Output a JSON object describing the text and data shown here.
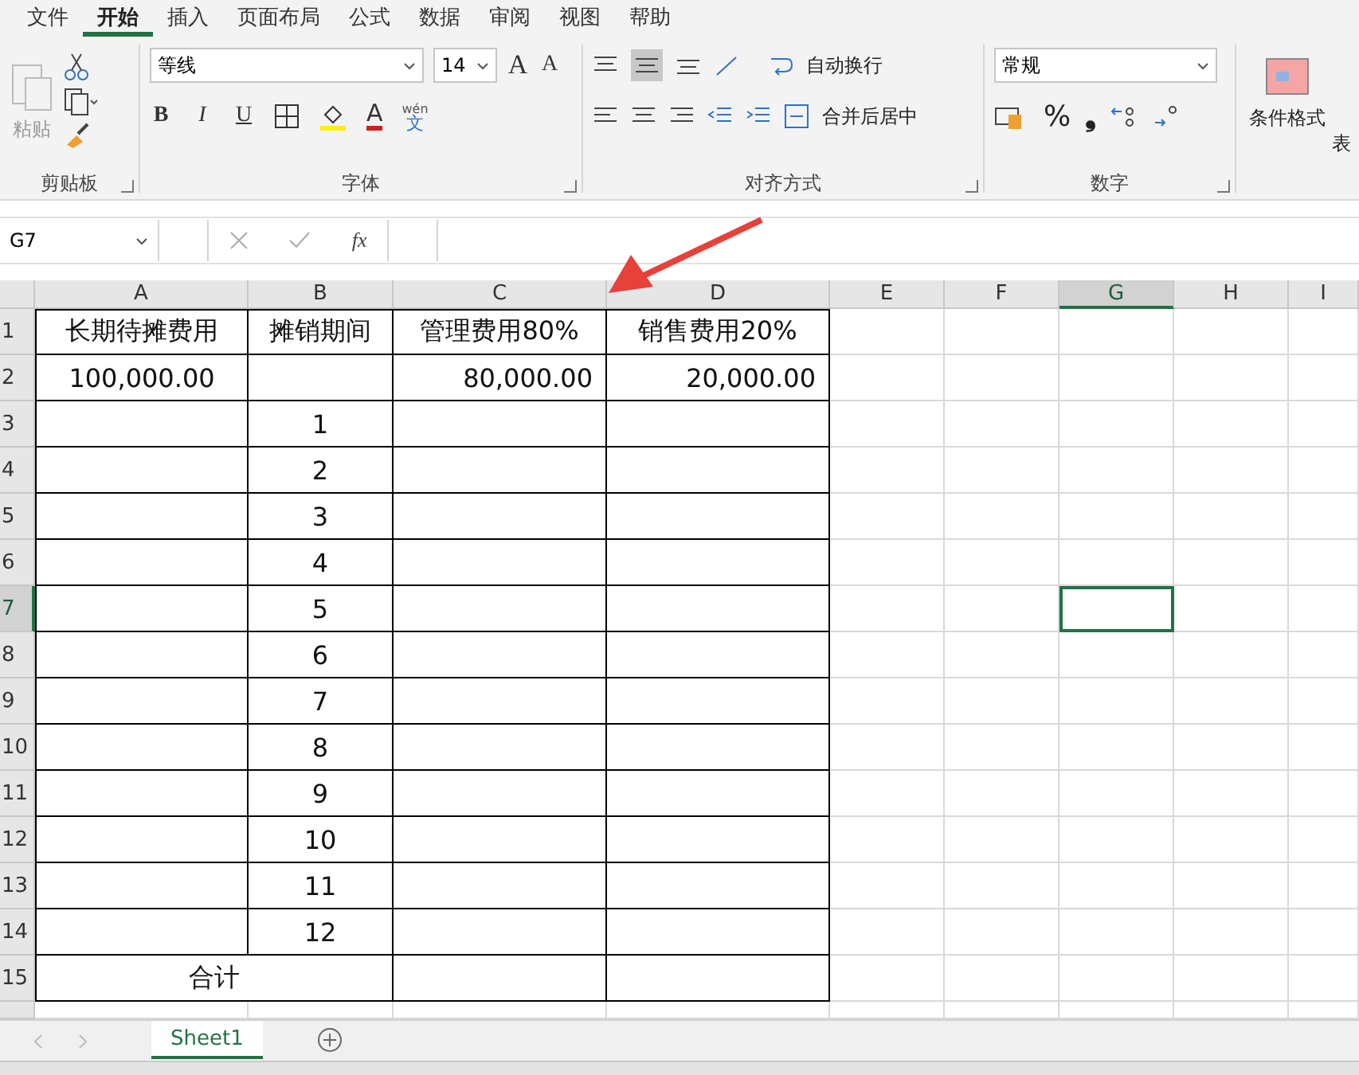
{
  "menu_tabs": [
    {
      "label": "文件",
      "selected": false
    },
    {
      "label": "开始",
      "selected": true
    },
    {
      "label": "插入",
      "selected": false
    },
    {
      "label": "页面布局",
      "selected": false
    },
    {
      "label": "公式",
      "selected": false
    },
    {
      "label": "数据",
      "selected": false
    },
    {
      "label": "审阅",
      "selected": false
    },
    {
      "label": "视图",
      "selected": false
    },
    {
      "label": "帮助",
      "selected": false
    }
  ],
  "ribbon": {
    "clipboard": {
      "paste": "粘贴",
      "label": "剪贴板"
    },
    "font": {
      "name": "等线",
      "size": "14",
      "grow": "A",
      "shrink": "A",
      "bold": "B",
      "italic": "I",
      "underline": "U",
      "font_color": "A",
      "phonetic_top": "wén",
      "phonetic_bottom": "文",
      "label": "字体"
    },
    "alignment": {
      "wrap": "自动换行",
      "merge": "合并后居中",
      "label": "对齐方式"
    },
    "number": {
      "format": "常规",
      "percent": "%",
      "comma": "❟",
      "label": "数字"
    },
    "styles": {
      "conditional": "条件格式",
      "table": "表"
    }
  },
  "formula_bar": {
    "name_box": "G7",
    "fx": "fx"
  },
  "columns": [
    {
      "label": "A",
      "selected": false
    },
    {
      "label": "B",
      "selected": false
    },
    {
      "label": "C",
      "selected": false
    },
    {
      "label": "D",
      "selected": false
    },
    {
      "label": "E",
      "selected": false
    },
    {
      "label": "F",
      "selected": false
    },
    {
      "label": "G",
      "selected": true
    },
    {
      "label": "H",
      "selected": false
    },
    {
      "label": "I",
      "selected": false
    }
  ],
  "rows": [
    {
      "header": "1",
      "kind": "header",
      "selected": false,
      "cells": [
        "长期待摊费用",
        "摊销期间",
        "管理费用80%",
        "销售费用20%"
      ]
    },
    {
      "header": "2",
      "kind": "data",
      "selected": false,
      "cells": [
        "100,000.00",
        "",
        "80,000.00",
        "20,000.00"
      ]
    },
    {
      "header": "3",
      "kind": "data",
      "selected": false,
      "cells": [
        "",
        "1",
        "",
        ""
      ]
    },
    {
      "header": "4",
      "kind": "data",
      "selected": false,
      "cells": [
        "",
        "2",
        "",
        ""
      ]
    },
    {
      "header": "5",
      "kind": "data",
      "selected": false,
      "cells": [
        "",
        "3",
        "",
        ""
      ]
    },
    {
      "header": "6",
      "kind": "data",
      "selected": false,
      "cells": [
        "",
        "4",
        "",
        ""
      ]
    },
    {
      "header": "7",
      "kind": "data",
      "selected": true,
      "cells": [
        "",
        "5",
        "",
        ""
      ]
    },
    {
      "header": "8",
      "kind": "data",
      "selected": false,
      "cells": [
        "",
        "6",
        "",
        ""
      ]
    },
    {
      "header": "9",
      "kind": "data",
      "selected": false,
      "cells": [
        "",
        "7",
        "",
        ""
      ]
    },
    {
      "header": "10",
      "kind": "data",
      "selected": false,
      "cells": [
        "",
        "8",
        "",
        ""
      ]
    },
    {
      "header": "11",
      "kind": "data",
      "selected": false,
      "cells": [
        "",
        "9",
        "",
        ""
      ]
    },
    {
      "header": "12",
      "kind": "data",
      "selected": false,
      "cells": [
        "",
        "10",
        "",
        ""
      ]
    },
    {
      "header": "13",
      "kind": "data",
      "selected": false,
      "cells": [
        "",
        "11",
        "",
        ""
      ]
    },
    {
      "header": "14",
      "kind": "data",
      "selected": false,
      "cells": [
        "",
        "12",
        "",
        ""
      ]
    },
    {
      "header": "15",
      "kind": "total",
      "selected": false,
      "cells": [
        "合计",
        "",
        ""
      ]
    }
  ],
  "sheet_tabs": [
    {
      "label": "Sheet1",
      "selected": true
    }
  ]
}
